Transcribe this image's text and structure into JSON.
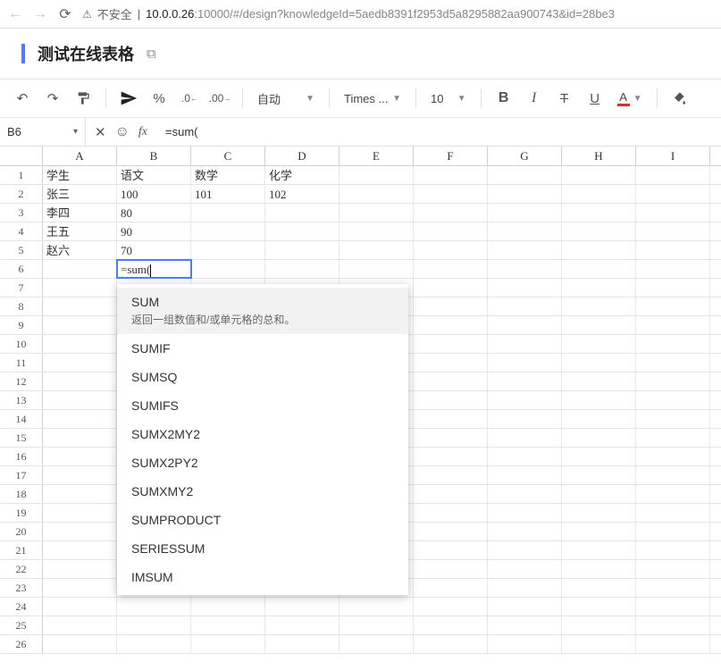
{
  "browser": {
    "insecure_label": "不安全",
    "url_host": "10.0.0.26",
    "url_port": ":10000",
    "url_path": "/#/design?knowledgeId=5aedb8391f2953d5a8295882aa900743&id=28be3"
  },
  "doc": {
    "title": "测试在线表格"
  },
  "toolbar": {
    "wrap_label": "自动",
    "font_label": "Times ...",
    "font_size": "10",
    "bold": "B",
    "italic": "I",
    "strike": "T",
    "underline": "U",
    "text_color": "A",
    "percent": "%"
  },
  "formula_bar": {
    "cell_ref": "B6",
    "formula": "=sum("
  },
  "columns": [
    "A",
    "B",
    "C",
    "D",
    "E",
    "F",
    "G",
    "H",
    "I"
  ],
  "row_count": 26,
  "data": {
    "1": {
      "A": "学生",
      "B": "语文",
      "C": "数学",
      "D": "化学"
    },
    "2": {
      "A": "张三",
      "B": "100",
      "C": "101",
      "D": "102"
    },
    "3": {
      "A": "李四",
      "B": "80"
    },
    "4": {
      "A": "王五",
      "B": "90"
    },
    "5": {
      "A": "赵六",
      "B": "70"
    },
    "6": {
      "B": "=sum("
    }
  },
  "editing_cell": "B6",
  "autocomplete": {
    "active_index": 0,
    "items": [
      {
        "name": "SUM",
        "desc": "返回一组数值和/或单元格的总和。"
      },
      {
        "name": "SUMIF"
      },
      {
        "name": "SUMSQ"
      },
      {
        "name": "SUMIFS"
      },
      {
        "name": "SUMX2MY2"
      },
      {
        "name": "SUMX2PY2"
      },
      {
        "name": "SUMXMY2"
      },
      {
        "name": "SUMPRODUCT"
      },
      {
        "name": "SERIESSUM"
      },
      {
        "name": "IMSUM"
      }
    ]
  }
}
